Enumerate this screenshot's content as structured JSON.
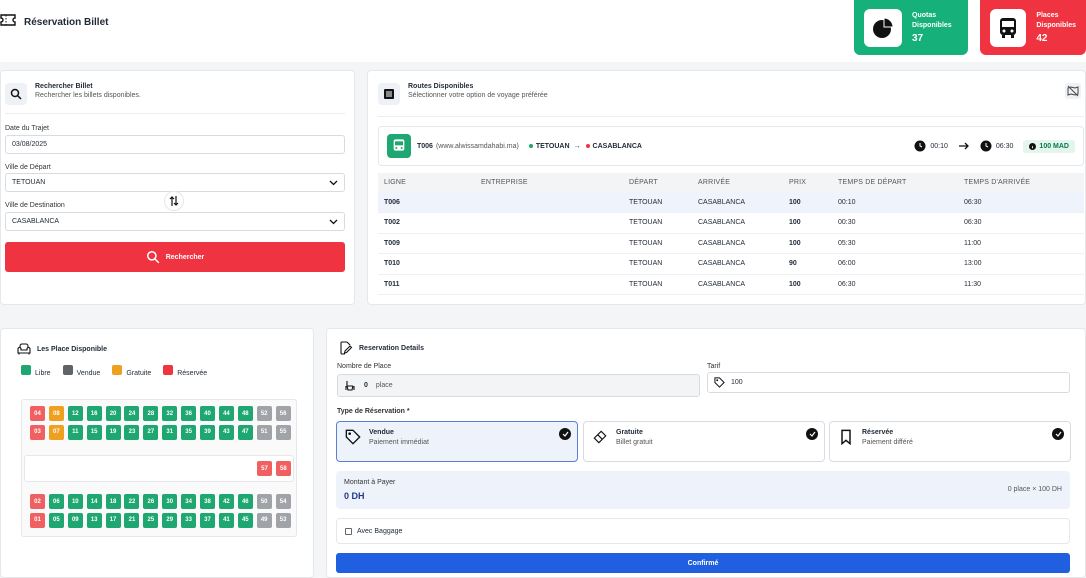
{
  "brand": {
    "title": "Réservation Billet"
  },
  "stats": [
    {
      "label1": "Quotas",
      "label2": "Disponibles",
      "value": "37",
      "color": "#16b07a"
    },
    {
      "label1": "Places",
      "label2": "Disponibles",
      "value": "42",
      "color": "#ef3340"
    }
  ],
  "search": {
    "title": "Rechercher Billet",
    "subtitle": "Rechercher les billets disponibles.",
    "date_label": "Date du Trajet",
    "date_value": "03/08/2025",
    "depart_label": "Ville de Départ",
    "depart_value": "TETOUAN",
    "dest_label": "Ville de Destination",
    "dest_value": "CASABLANCA",
    "button": "Rechercher"
  },
  "routes": {
    "title": "Routes Disponibles",
    "subtitle": "Sélectionner votre option de voyage préférée",
    "selected": {
      "code": "T006",
      "site": "(www.alwissamdahabi.ma)",
      "from": "TETOUAN",
      "arrow": "→",
      "to": "CASABLANCA",
      "dep_time": "00:10",
      "arr_time": "06:30",
      "price": "100 MAD"
    },
    "columns": [
      "LIGNE",
      "ENTREPRISE",
      "DÉPART",
      "ARRIVÉE",
      "PRIX",
      "TEMPS DE DÉPART",
      "TEMPS D'ARRIVÉE"
    ],
    "rows": [
      {
        "ligne": "T006",
        "entreprise": "",
        "depart": "TETOUAN",
        "arrivee": "CASABLANCA",
        "prix": "100",
        "tdep": "00:10",
        "tarr": "06:30"
      },
      {
        "ligne": "T002",
        "entreprise": "",
        "depart": "TETOUAN",
        "arrivee": "CASABLANCA",
        "prix": "100",
        "tdep": "00:30",
        "tarr": "06:30"
      },
      {
        "ligne": "T009",
        "entreprise": "",
        "depart": "TETOUAN",
        "arrivee": "CASABLANCA",
        "prix": "100",
        "tdep": "05:30",
        "tarr": "11:00"
      },
      {
        "ligne": "T010",
        "entreprise": "",
        "depart": "TETOUAN",
        "arrivee": "CASABLANCA",
        "prix": "90",
        "tdep": "06:00",
        "tarr": "13:00"
      },
      {
        "ligne": "T011",
        "entreprise": "",
        "depart": "TETOUAN",
        "arrivee": "CASABLANCA",
        "prix": "100",
        "tdep": "06:30",
        "tarr": "11:30"
      }
    ]
  },
  "seats": {
    "title": "Les Place Disponible",
    "legend": [
      {
        "label": "Libre",
        "color": "#1ea771"
      },
      {
        "label": "Vendue",
        "color": "#5f6368"
      },
      {
        "label": "Gratuite",
        "color": "#f0a020"
      },
      {
        "label": "Réservée",
        "color": "#ef3340"
      }
    ],
    "upper": [
      [
        {
          "n": "04",
          "s": "reserved"
        },
        {
          "n": "08",
          "s": "gratuit"
        },
        {
          "n": "12",
          "s": "free"
        },
        {
          "n": "16",
          "s": "free"
        },
        {
          "n": "20",
          "s": "free"
        },
        {
          "n": "24",
          "s": "free"
        },
        {
          "n": "28",
          "s": "free"
        },
        {
          "n": "32",
          "s": "free"
        },
        {
          "n": "36",
          "s": "free"
        },
        {
          "n": "40",
          "s": "free"
        },
        {
          "n": "44",
          "s": "free"
        },
        {
          "n": "48",
          "s": "free"
        },
        {
          "n": "52",
          "s": "sold"
        },
        {
          "n": "56",
          "s": "sold"
        }
      ],
      [
        {
          "n": "03",
          "s": "reserved"
        },
        {
          "n": "07",
          "s": "gratuit"
        },
        {
          "n": "11",
          "s": "free"
        },
        {
          "n": "15",
          "s": "free"
        },
        {
          "n": "19",
          "s": "free"
        },
        {
          "n": "23",
          "s": "free"
        },
        {
          "n": "27",
          "s": "free"
        },
        {
          "n": "31",
          "s": "free"
        },
        {
          "n": "35",
          "s": "free"
        },
        {
          "n": "39",
          "s": "free"
        },
        {
          "n": "43",
          "s": "free"
        },
        {
          "n": "47",
          "s": "free"
        },
        {
          "n": "51",
          "s": "sold"
        },
        {
          "n": "55",
          "s": "sold"
        }
      ]
    ],
    "middle": [
      {
        "n": "57",
        "s": "reserved"
      },
      {
        "n": "58",
        "s": "reserved"
      }
    ],
    "lower": [
      [
        {
          "n": "02",
          "s": "reserved"
        },
        {
          "n": "06",
          "s": "free"
        },
        {
          "n": "10",
          "s": "free"
        },
        {
          "n": "14",
          "s": "free"
        },
        {
          "n": "18",
          "s": "free"
        },
        {
          "n": "22",
          "s": "free"
        },
        {
          "n": "26",
          "s": "free"
        },
        {
          "n": "30",
          "s": "free"
        },
        {
          "n": "34",
          "s": "free"
        },
        {
          "n": "38",
          "s": "free"
        },
        {
          "n": "42",
          "s": "free"
        },
        {
          "n": "46",
          "s": "free"
        },
        {
          "n": "50",
          "s": "sold"
        },
        {
          "n": "54",
          "s": "sold"
        }
      ],
      [
        {
          "n": "01",
          "s": "reserved"
        },
        {
          "n": "05",
          "s": "free"
        },
        {
          "n": "09",
          "s": "free"
        },
        {
          "n": "13",
          "s": "free"
        },
        {
          "n": "17",
          "s": "free"
        },
        {
          "n": "21",
          "s": "free"
        },
        {
          "n": "25",
          "s": "free"
        },
        {
          "n": "29",
          "s": "free"
        },
        {
          "n": "33",
          "s": "free"
        },
        {
          "n": "37",
          "s": "free"
        },
        {
          "n": "41",
          "s": "free"
        },
        {
          "n": "45",
          "s": "free"
        },
        {
          "n": "49",
          "s": "sold"
        },
        {
          "n": "53",
          "s": "sold"
        }
      ]
    ]
  },
  "reservation": {
    "title": "Reservation Details",
    "nb_label": "Nombre de Place",
    "nb_value": "0",
    "nb_unit": "place",
    "tarif_label": "Tarif",
    "tarif_value": "100",
    "type_label": "Type de Réservation *",
    "types": [
      {
        "title": "Vendue",
        "sub": "Paiement immédiat"
      },
      {
        "title": "Gratuite",
        "sub": "Billet gratuit"
      },
      {
        "title": "Réservée",
        "sub": "Paiement différé"
      }
    ],
    "amount_label": "Montant à Payer",
    "amount_value": "0 DH",
    "amount_calc": "0 place × 100 DH",
    "baggage": "Avec Baggage",
    "confirm": "Confirmé"
  }
}
